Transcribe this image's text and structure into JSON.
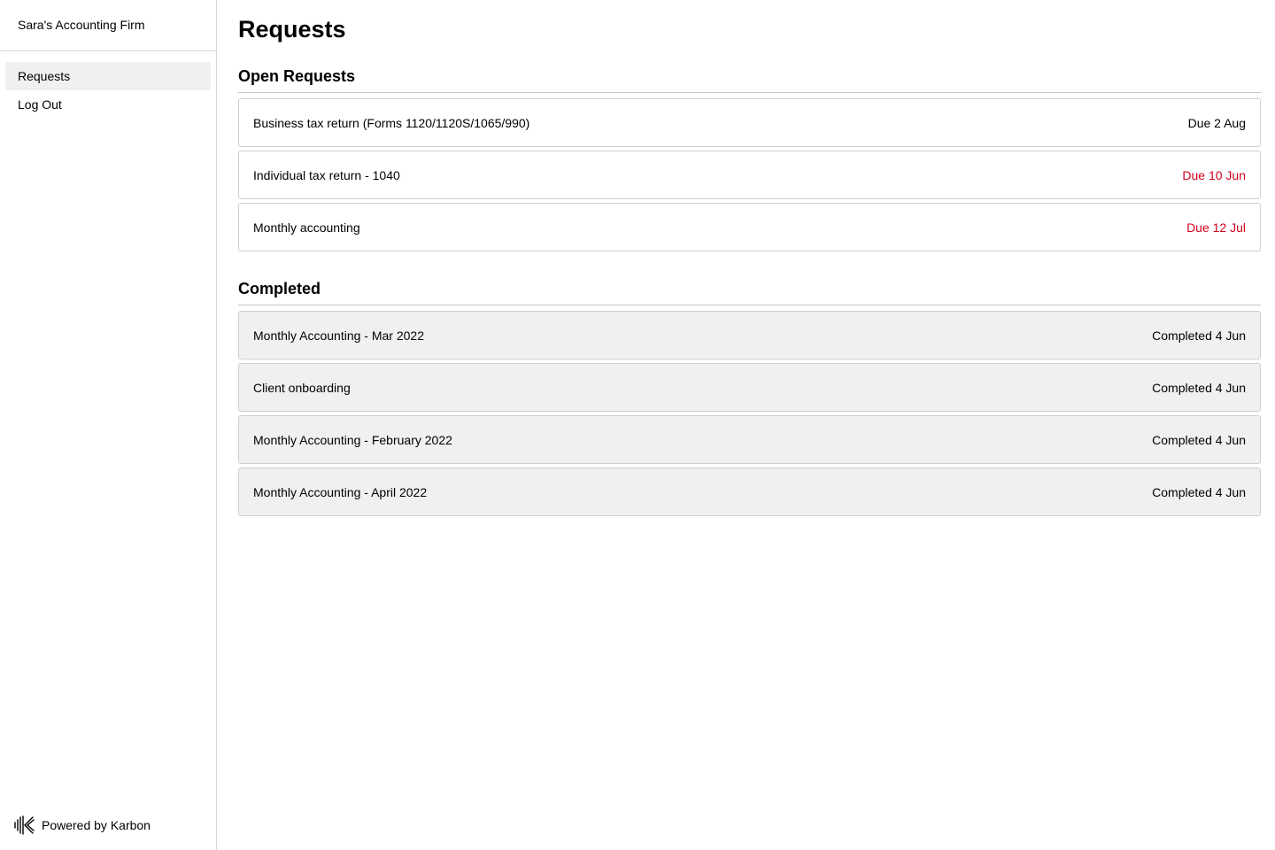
{
  "sidebar": {
    "firm_name": "Sara's Accounting Firm",
    "nav": [
      {
        "label": "Requests",
        "active": true
      },
      {
        "label": "Log Out",
        "active": false
      }
    ],
    "powered_by": "Powered by Karbon",
    "logo_icon": "karbon-logo-icon"
  },
  "main": {
    "title": "Requests",
    "open_section": {
      "title": "Open Requests",
      "items": [
        {
          "title": "Business tax return (Forms 1120/1120S/1065/990)",
          "date": "Due 2 Aug",
          "overdue": false
        },
        {
          "title": "Individual tax return - 1040",
          "date": "Due 10 Jun",
          "overdue": true
        },
        {
          "title": "Monthly accounting",
          "date": "Due 12 Jul",
          "overdue": true
        }
      ]
    },
    "completed_section": {
      "title": "Completed",
      "items": [
        {
          "title": "Monthly Accounting - Mar 2022",
          "date": "Completed 4 Jun"
        },
        {
          "title": "Client onboarding",
          "date": "Completed 4 Jun"
        },
        {
          "title": "Monthly Accounting - February 2022",
          "date": "Completed 4 Jun"
        },
        {
          "title": "Monthly Accounting - April 2022",
          "date": "Completed 4 Jun"
        }
      ]
    }
  },
  "colors": {
    "overdue": "#d0021b",
    "completed_bg": "#f0f0f0",
    "active_nav_bg": "#f0f0f0",
    "border": "#cfcfcf"
  }
}
